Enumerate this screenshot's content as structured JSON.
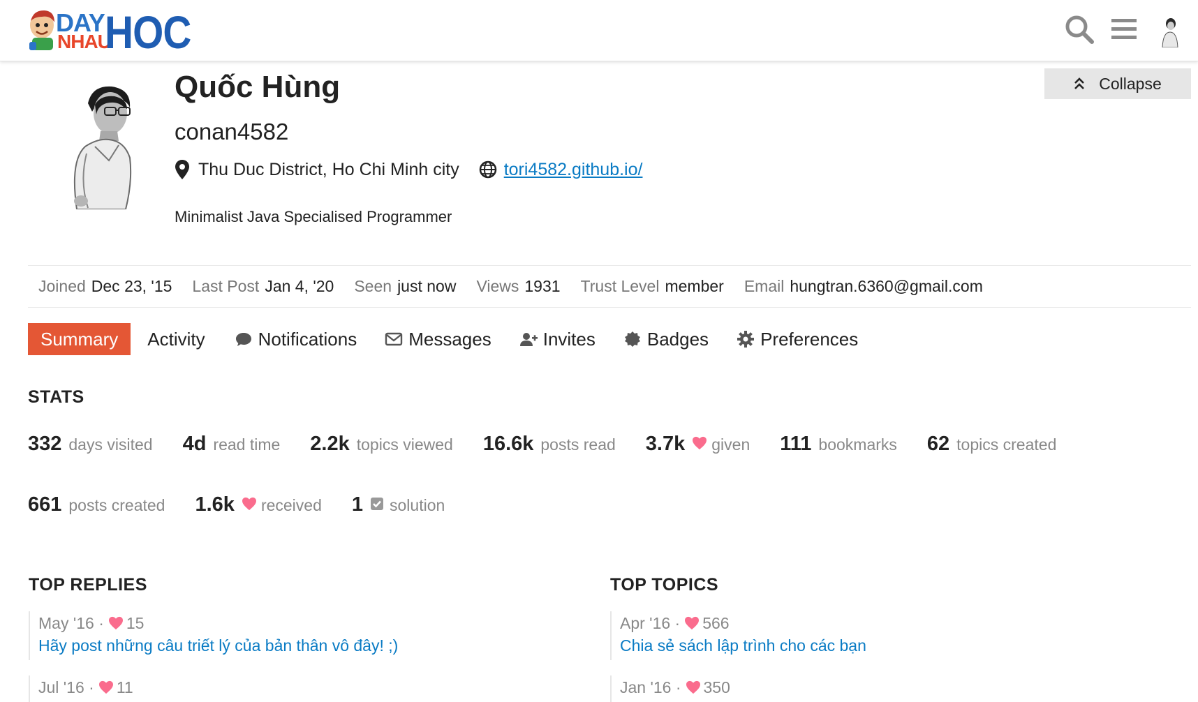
{
  "header": {
    "logo": {
      "day": "DAY",
      "nhau": "NHAU",
      "hoc": "HOC"
    },
    "icons": [
      "search-icon",
      "hamburger-menu-icon",
      "user-avatar"
    ]
  },
  "profile": {
    "name": "Quốc Hùng",
    "username": "conan4582",
    "location": "Thu Duc District, Ho Chi Minh city",
    "website": "tori4582.github.io/",
    "bio": "Minimalist Java Specialised Programmer",
    "collapse_label": "Collapse"
  },
  "meta": {
    "joined_label": "Joined",
    "joined_value": "Dec 23, '15",
    "lastpost_label": "Last Post",
    "lastpost_value": "Jan 4, '20",
    "seen_label": "Seen",
    "seen_value": "just now",
    "views_label": "Views",
    "views_value": "1931",
    "trust_label": "Trust Level",
    "trust_value": "member",
    "email_label": "Email",
    "email_value": "hungtran.6360@gmail.com"
  },
  "tabs": [
    {
      "label": "Summary",
      "active": true
    },
    {
      "label": "Activity"
    },
    {
      "label": "Notifications",
      "icon": "comment-icon"
    },
    {
      "label": "Messages",
      "icon": "envelope-icon"
    },
    {
      "label": "Invites",
      "icon": "user-plus-icon"
    },
    {
      "label": "Badges",
      "icon": "certificate-icon"
    },
    {
      "label": "Preferences",
      "icon": "gear-icon"
    }
  ],
  "stats": {
    "title": "STATS",
    "items": [
      {
        "num": "332",
        "desc": "days visited"
      },
      {
        "num": "4d",
        "desc": "read time"
      },
      {
        "num": "2.2k",
        "desc": "topics viewed"
      },
      {
        "num": "16.6k",
        "desc": "posts read"
      },
      {
        "num": "3.7k",
        "desc": "given"
      },
      {
        "num": "111",
        "desc": "bookmarks"
      },
      {
        "num": "62",
        "desc": "topics created"
      },
      {
        "num": "661",
        "desc": "posts created"
      },
      {
        "num": "1.6k",
        "desc": "received"
      },
      {
        "num": "1",
        "desc": "solution"
      }
    ]
  },
  "top_replies": {
    "title": "TOP REPLIES",
    "items": [
      {
        "date": "May '16",
        "sep": "·",
        "likes": "15",
        "title": "Hãy post những câu triết lý của bản thân vô đây! ;)"
      },
      {
        "date": "Jul '16",
        "sep": "·",
        "likes": "11"
      }
    ]
  },
  "top_topics": {
    "title": "TOP TOPICS",
    "items": [
      {
        "date": "Apr '16",
        "sep": "·",
        "likes": "566",
        "title": "Chia sẻ sách lập trình cho các bạn"
      },
      {
        "date": "Jan '16",
        "sep": "·",
        "likes": "350"
      }
    ]
  },
  "colors": {
    "accent": "#e45735",
    "link": "#0a7bc4",
    "heart": "#fa6c8d"
  }
}
